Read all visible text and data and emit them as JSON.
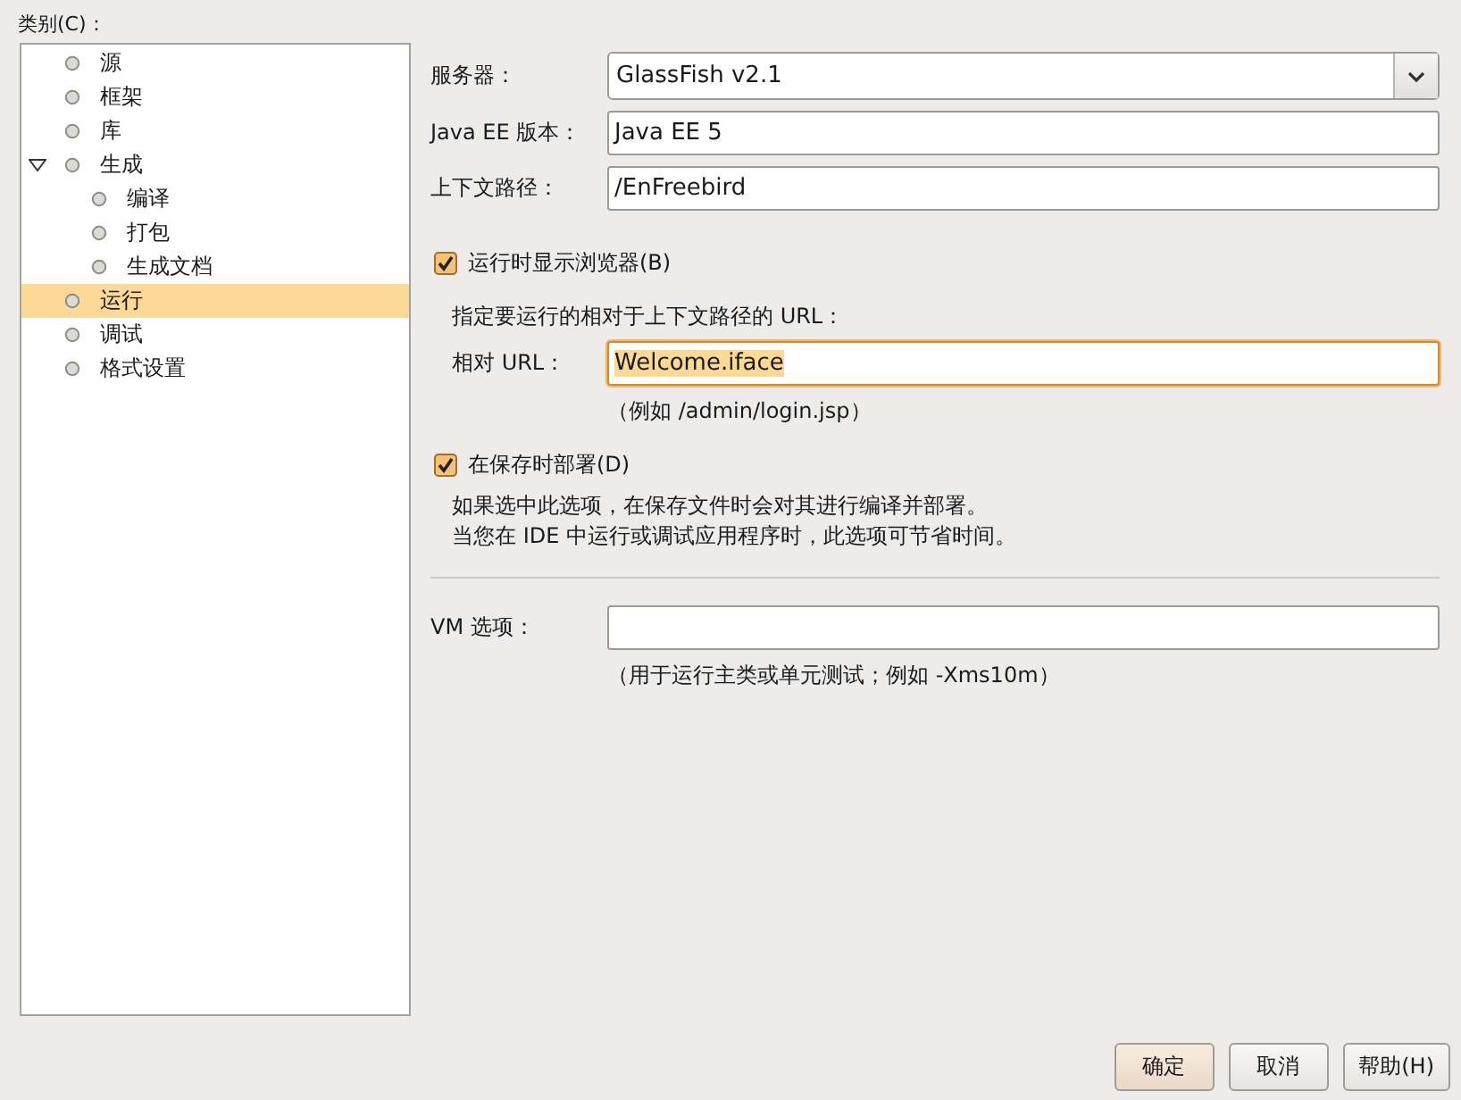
{
  "category_label": "类别(C)：",
  "tree": [
    {
      "label": "源",
      "selected": false
    },
    {
      "label": "框架",
      "selected": false
    },
    {
      "label": "库",
      "selected": false
    },
    {
      "label": "生成",
      "selected": false,
      "expanded": true,
      "children": [
        {
          "label": "编译",
          "selected": false
        },
        {
          "label": "打包",
          "selected": false
        },
        {
          "label": "生成文档",
          "selected": false
        }
      ]
    },
    {
      "label": "运行",
      "selected": true
    },
    {
      "label": "调试",
      "selected": false
    },
    {
      "label": "格式设置",
      "selected": false
    }
  ],
  "fields": [
    {
      "kind": "select",
      "label": "服务器：",
      "value": "GlassFish v2.1"
    },
    {
      "kind": "text",
      "label": "Java EE 版本：",
      "value": "Java EE 5"
    },
    {
      "kind": "text",
      "label": "上下文路径：",
      "value": "/EnFreebird"
    }
  ],
  "show_browser": {
    "label": "运行时显示浏览器(B)",
    "checked": true
  },
  "relative_url_note": "指定要运行的相对于上下文路径的 URL：",
  "relative_url": {
    "label": "相对 URL：",
    "value": "Welcome.iface",
    "focused": true
  },
  "relative_url_example": "（例如 /admin/login.jsp）",
  "deploy_on_save": {
    "label": "在保存时部署(D)",
    "checked": true
  },
  "deploy_description": [
    "如果选中此选项，在保存文件时会对其进行编译并部署。",
    "当您在 IDE 中运行或调试应用程序时，此选项可节省时间。"
  ],
  "vm_options": {
    "label": "VM 选项："
  },
  "vm_hint": "（用于运行主类或单元测试；例如 -Xms10m）",
  "buttons": [
    "确定",
    "取消",
    "帮助(H)"
  ]
}
